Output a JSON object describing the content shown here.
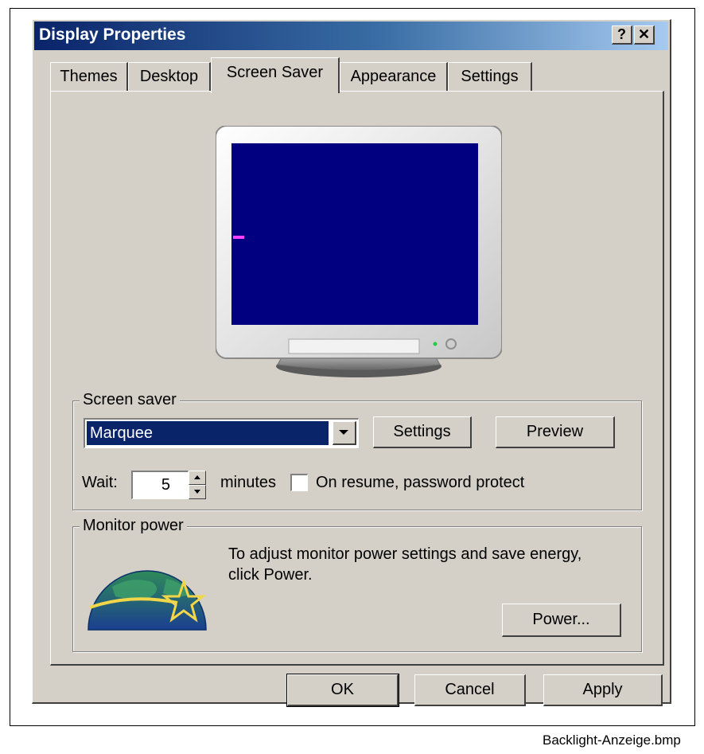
{
  "window": {
    "title": "Display Properties",
    "help_glyph": "?",
    "close_glyph": "✕"
  },
  "tabs": [
    {
      "label": "Themes",
      "active": false
    },
    {
      "label": "Desktop",
      "active": false
    },
    {
      "label": "Screen Saver",
      "active": true
    },
    {
      "label": "Appearance",
      "active": false
    },
    {
      "label": "Settings",
      "active": false
    }
  ],
  "screen_saver": {
    "group_label": "Screen saver",
    "selected": "Marquee",
    "settings_label": "Settings",
    "preview_label": "Preview",
    "wait_label": "Wait:",
    "wait_value": "5",
    "minutes_label": "minutes",
    "password_label": "On resume, password protect",
    "password_checked": false
  },
  "monitor_power": {
    "group_label": "Monitor power",
    "text_line1": "To adjust monitor power settings and save energy,",
    "text_line2": "click Power.",
    "power_label": "Power..."
  },
  "footer": {
    "ok_label": "OK",
    "cancel_label": "Cancel",
    "apply_label": "Apply"
  },
  "file_caption": "Backlight-Anzeige.bmp",
  "colors": {
    "face": "#d4d0c8",
    "title_start": "#0a246a",
    "screen": "#000080",
    "selection": "#0a246a"
  }
}
